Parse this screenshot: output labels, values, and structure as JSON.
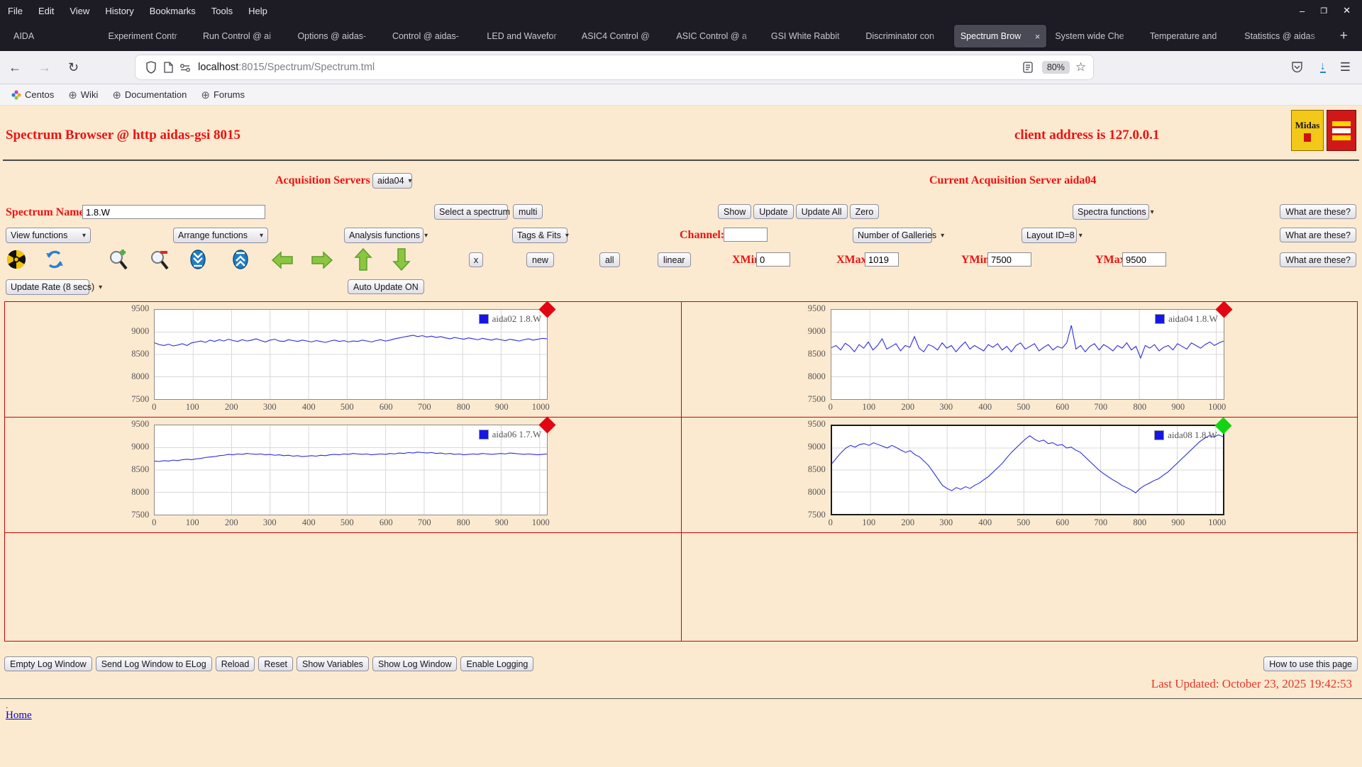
{
  "browser": {
    "menu": [
      "File",
      "Edit",
      "View",
      "History",
      "Bookmarks",
      "Tools",
      "Help"
    ],
    "window_controls": {
      "minimize": "–",
      "maximize": "❐",
      "close": "✕"
    },
    "tabs": [
      {
        "label": "AIDA",
        "active": false
      },
      {
        "label": "Experiment Contr",
        "active": false
      },
      {
        "label": "Run Control @ ai",
        "active": false
      },
      {
        "label": "Options @ aidas-",
        "active": false
      },
      {
        "label": "Control @ aidas-",
        "active": false
      },
      {
        "label": "LED and Wavefor",
        "active": false
      },
      {
        "label": "ASIC4 Control @",
        "active": false
      },
      {
        "label": "ASIC Control @ a",
        "active": false
      },
      {
        "label": "GSI White Rabbit",
        "active": false
      },
      {
        "label": "Discriminator con",
        "active": false
      },
      {
        "label": "Spectrum Brow",
        "active": true
      },
      {
        "label": "System wide Che",
        "active": false
      },
      {
        "label": "Temperature and",
        "active": false
      },
      {
        "label": "Statistics @ aidas",
        "active": false
      }
    ],
    "new_tab_label": "+",
    "url_host": "localhost",
    "url_rest": ":8015/Spectrum/Spectrum.tml",
    "zoom_level": "80%",
    "bookmarks": [
      "Centos",
      "Wiki",
      "Documentation",
      "Forums"
    ]
  },
  "header": {
    "title": "Spectrum Browser @ http aidas-gsi 8015",
    "client": "client address is 127.0.0.1",
    "logo1_text": "Midas"
  },
  "controls": {
    "acquisition_label": "Acquisition Servers",
    "acquisition_selected": "aida04",
    "current_server": "Current Acquisition Server aida04",
    "spectrum_name_label": "Spectrum Name:",
    "spectrum_name_value": "1.8.W",
    "select_spectrum": "Select a spectrum",
    "multi": "multi",
    "show": "Show",
    "update": "Update",
    "update_all": "Update All",
    "zero": "Zero",
    "spectra_functions": "Spectra functions",
    "what_are_these": "What are these?",
    "view_functions": "View functions",
    "arrange_functions": "Arrange functions",
    "analysis_functions": "Analysis functions",
    "tags_fits": "Tags & Fits",
    "channel_label": "Channel:",
    "channel_value": "",
    "number_of_galleries": "Number of Galleries",
    "layout_id": "Layout ID=8",
    "x_button": "x",
    "new_button": "new",
    "all_button": "all",
    "linear_button": "linear",
    "xmin_label": "XMin",
    "xmin_value": "0",
    "xmax_label": "XMax",
    "xmax_value": "1019",
    "ymin_label": "YMin",
    "ymin_value": "7500",
    "ymax_label": "YMax",
    "ymax_value": "9500",
    "update_rate": "Update Rate (8 secs)",
    "auto_update": "Auto Update ON"
  },
  "footer": {
    "buttons": [
      "Empty Log Window",
      "Send Log Window to ELog",
      "Reload",
      "Reset",
      "Show Variables",
      "Show Log Window",
      "Enable Logging"
    ],
    "help_button": "How to use this page",
    "last_updated": "Last Updated: October 23, 2025 19:42:53",
    "dot": ".",
    "home": "Home"
  },
  "chart_data": [
    {
      "type": "line",
      "legend": "aida02 1.8.W",
      "line_color": "#2a2ae0",
      "marker_color": "#e20613",
      "selected": false,
      "xlim": [
        0,
        1019
      ],
      "ylim": [
        7500,
        9500
      ],
      "x_ticks": [
        0,
        100,
        200,
        300,
        400,
        500,
        600,
        700,
        800,
        900,
        1000
      ],
      "y_ticks": [
        7500,
        8000,
        8500,
        9000,
        9500
      ],
      "values": [
        8760,
        8720,
        8700,
        8730,
        8690,
        8710,
        8740,
        8700,
        8760,
        8780,
        8800,
        8770,
        8820,
        8790,
        8830,
        8800,
        8840,
        8810,
        8790,
        8830,
        8800,
        8820,
        8850,
        8810,
        8780,
        8820,
        8840,
        8800,
        8790,
        8830,
        8810,
        8790,
        8820,
        8800,
        8780,
        8810,
        8790,
        8770,
        8800,
        8820,
        8790,
        8810,
        8780,
        8800,
        8790,
        8820,
        8800,
        8780,
        8810,
        8830,
        8800,
        8820,
        8850,
        8870,
        8890,
        8910,
        8930,
        8900,
        8920,
        8890,
        8910,
        8880,
        8900,
        8870,
        8850,
        8880,
        8860,
        8840,
        8870,
        8850,
        8830,
        8860,
        8840,
        8820,
        8850,
        8830,
        8810,
        8840,
        8820,
        8800,
        8830,
        8850,
        8820,
        8840,
        8860,
        8850
      ]
    },
    {
      "type": "line",
      "legend": "aida04 1.8.W",
      "line_color": "#2a2ae0",
      "marker_color": "#e20613",
      "selected": false,
      "xlim": [
        0,
        1019
      ],
      "ylim": [
        7500,
        9500
      ],
      "x_ticks": [
        0,
        100,
        200,
        300,
        400,
        500,
        600,
        700,
        800,
        900,
        1000
      ],
      "y_ticks": [
        7500,
        8000,
        8500,
        9000,
        9500
      ],
      "values": [
        8650,
        8700,
        8600,
        8750,
        8680,
        8560,
        8720,
        8640,
        8780,
        8600,
        8700,
        8850,
        8620,
        8680,
        8740,
        8580,
        8700,
        8660,
        8900,
        8640,
        8560,
        8720,
        8680,
        8600,
        8760,
        8640,
        8700,
        8560,
        8680,
        8780,
        8620,
        8700,
        8640,
        8580,
        8720,
        8660,
        8740,
        8600,
        8680,
        8560,
        8700,
        8760,
        8620,
        8680,
        8740,
        8580,
        8660,
        8720,
        8600,
        8680,
        8640,
        8760,
        9150,
        8620,
        8700,
        8560,
        8680,
        8740,
        8600,
        8720,
        8660,
        8580,
        8700,
        8640,
        8760,
        8600,
        8680,
        8420,
        8700,
        8640,
        8720,
        8580,
        8660,
        8700,
        8600,
        8740,
        8680,
        8620,
        8760,
        8700,
        8640,
        8720,
        8780,
        8700,
        8760,
        8800
      ]
    },
    {
      "type": "line",
      "legend": "aida06 1.7.W",
      "line_color": "#2a2ae0",
      "marker_color": "#e20613",
      "selected": false,
      "xlim": [
        0,
        1019
      ],
      "ylim": [
        7500,
        9500
      ],
      "x_ticks": [
        0,
        100,
        200,
        300,
        400,
        500,
        600,
        700,
        800,
        900,
        1000
      ],
      "y_ticks": [
        7500,
        8000,
        8500,
        9000,
        9500
      ],
      "values": [
        8700,
        8690,
        8710,
        8700,
        8720,
        8710,
        8730,
        8740,
        8730,
        8750,
        8760,
        8780,
        8790,
        8800,
        8820,
        8830,
        8850,
        8840,
        8860,
        8850,
        8870,
        8860,
        8850,
        8860,
        8840,
        8850,
        8830,
        8840,
        8820,
        8830,
        8810,
        8820,
        8800,
        8810,
        8820,
        8810,
        8830,
        8820,
        8840,
        8850,
        8840,
        8860,
        8850,
        8870,
        8860,
        8850,
        8860,
        8840,
        8850,
        8860,
        8850,
        8870,
        8860,
        8880,
        8870,
        8890,
        8880,
        8900,
        8890,
        8880,
        8890,
        8870,
        8880,
        8860,
        8870,
        8850,
        8860,
        8840,
        8850,
        8860,
        8850,
        8870,
        8860,
        8850,
        8860,
        8870,
        8860,
        8880,
        8870,
        8860,
        8850,
        8860,
        8850,
        8840,
        8850,
        8860
      ]
    },
    {
      "type": "line",
      "legend": "aida08 1.8.W",
      "line_color": "#2a2ae0",
      "marker_color": "#12d412",
      "selected": true,
      "xlim": [
        0,
        1019
      ],
      "ylim": [
        7500,
        9500
      ],
      "x_ticks": [
        0,
        100,
        200,
        300,
        400,
        500,
        600,
        700,
        800,
        900,
        1000
      ],
      "y_ticks": [
        7500,
        8000,
        8500,
        9000,
        9500
      ],
      "values": [
        8650,
        8780,
        8900,
        9000,
        9060,
        9020,
        9080,
        9100,
        9060,
        9120,
        9080,
        9040,
        9000,
        9060,
        9010,
        8950,
        8900,
        8940,
        8850,
        8800,
        8700,
        8600,
        8450,
        8300,
        8150,
        8080,
        8030,
        8100,
        8060,
        8120,
        8080,
        8150,
        8200,
        8280,
        8350,
        8450,
        8550,
        8650,
        8780,
        8900,
        9000,
        9100,
        9200,
        9280,
        9200,
        9150,
        9180,
        9100,
        9120,
        9060,
        9080,
        9000,
        9020,
        8950,
        8900,
        8800,
        8700,
        8600,
        8500,
        8420,
        8350,
        8280,
        8220,
        8150,
        8100,
        8050,
        7980,
        8080,
        8150,
        8200,
        8260,
        8300,
        8380,
        8450,
        8550,
        8650,
        8750,
        8850,
        8950,
        9050,
        9150,
        9220,
        9280,
        9250,
        9300,
        9260
      ]
    }
  ]
}
